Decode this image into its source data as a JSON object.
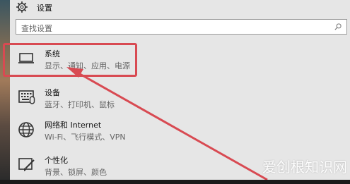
{
  "header": {
    "title": "设置"
  },
  "search": {
    "placeholder": "查找设置"
  },
  "items": [
    {
      "title": "系统",
      "subtitle": "显示、通知、应用、电源",
      "icon": "laptop-icon"
    },
    {
      "title": "设备",
      "subtitle": "蓝牙、打印机、鼠标",
      "icon": "devices-icon"
    },
    {
      "title": "网络和 Internet",
      "subtitle": "Wi-Fi、飞行模式、VPN",
      "icon": "globe-icon"
    },
    {
      "title": "个性化",
      "subtitle": "背景、锁屏、颜色",
      "icon": "paint-icon"
    }
  ],
  "annotation": {
    "color": "#d84a52"
  },
  "watermark": {
    "text": "爱创根知识网"
  }
}
